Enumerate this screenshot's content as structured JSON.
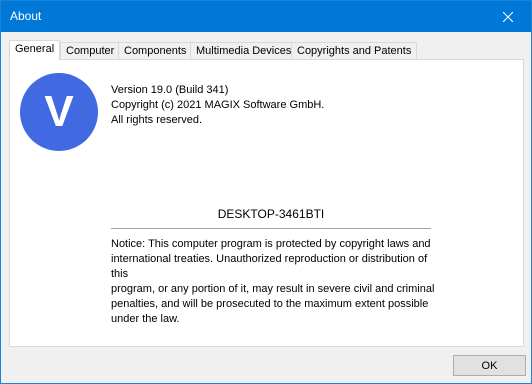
{
  "window": {
    "title": "About"
  },
  "tabs": [
    {
      "label": "General",
      "active": true
    },
    {
      "label": "Computer",
      "active": false
    },
    {
      "label": "Components",
      "active": false
    },
    {
      "label": "Multimedia Devices",
      "active": false
    },
    {
      "label": "Copyrights and Patents",
      "active": false
    }
  ],
  "general": {
    "logo_letter": "V",
    "logo_color": "#4169e1",
    "version": "Version 19.0 (Build 341)",
    "copyright": "Copyright (c) 2021 MAGIX Software GmbH.",
    "rights": "All rights reserved.",
    "computer_name": "DESKTOP-3461BTI",
    "notice_lines": [
      "Notice: This computer program is protected by copyright laws and",
      "international treaties. Unauthorized reproduction or distribution of this",
      "program, or any portion of it, may result in severe civil and criminal",
      "penalties, and will be prosecuted to the maximum extent possible",
      "under the law."
    ]
  },
  "buttons": {
    "ok_label": "OK"
  },
  "icons": {
    "close": "close-icon"
  }
}
